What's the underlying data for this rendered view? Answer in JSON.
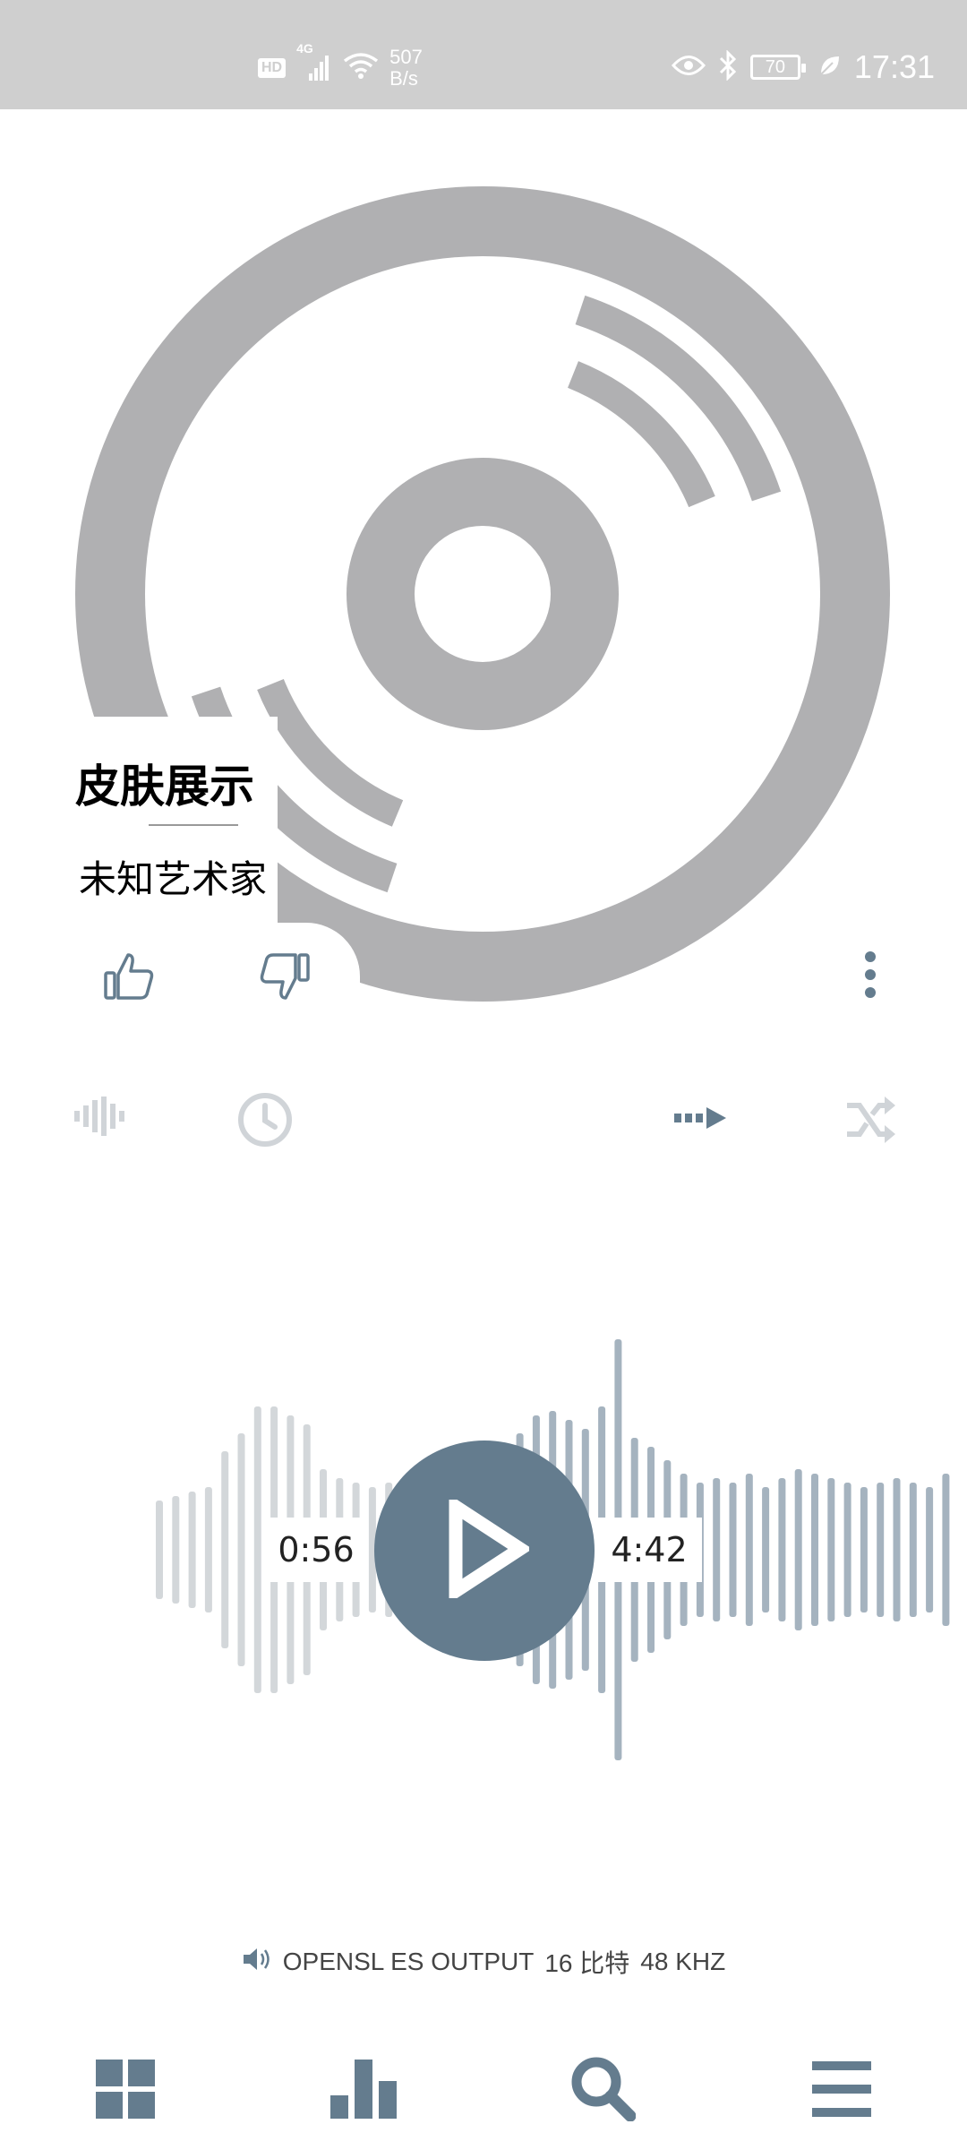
{
  "status_bar": {
    "network_hd": "HD",
    "network_type": "4G",
    "speed_value": "507",
    "speed_unit": "B/s",
    "battery": "70",
    "time": "17:31"
  },
  "player": {
    "song_title": "皮肤展示",
    "artist": "未知艺术家",
    "elapsed": "0:56",
    "total": "4:42",
    "playback_state": "paused",
    "progress_fraction": 0.2
  },
  "output": {
    "driver": "OPENSL ES OUTPUT",
    "bit_depth": "16 比特",
    "sample_rate": "48 KHZ"
  },
  "icons": {
    "like": "thumbs-up-icon",
    "dislike": "thumbs-down-icon",
    "more": "more-vertical-icon",
    "visualizer": "waveform-icon",
    "timer": "clock-icon",
    "repeat": "repeat-order-icon",
    "shuffle": "shuffle-icon",
    "nav": [
      "grid-icon",
      "bar-chart-icon",
      "search-icon",
      "menu-icon"
    ]
  },
  "colors": {
    "accent": "#647c8e",
    "disc": "#b0b0b2",
    "wave_played": "#d3d7da",
    "wave_remaining": "#a5b3bf",
    "status_bar": "#cfcfcf"
  }
}
